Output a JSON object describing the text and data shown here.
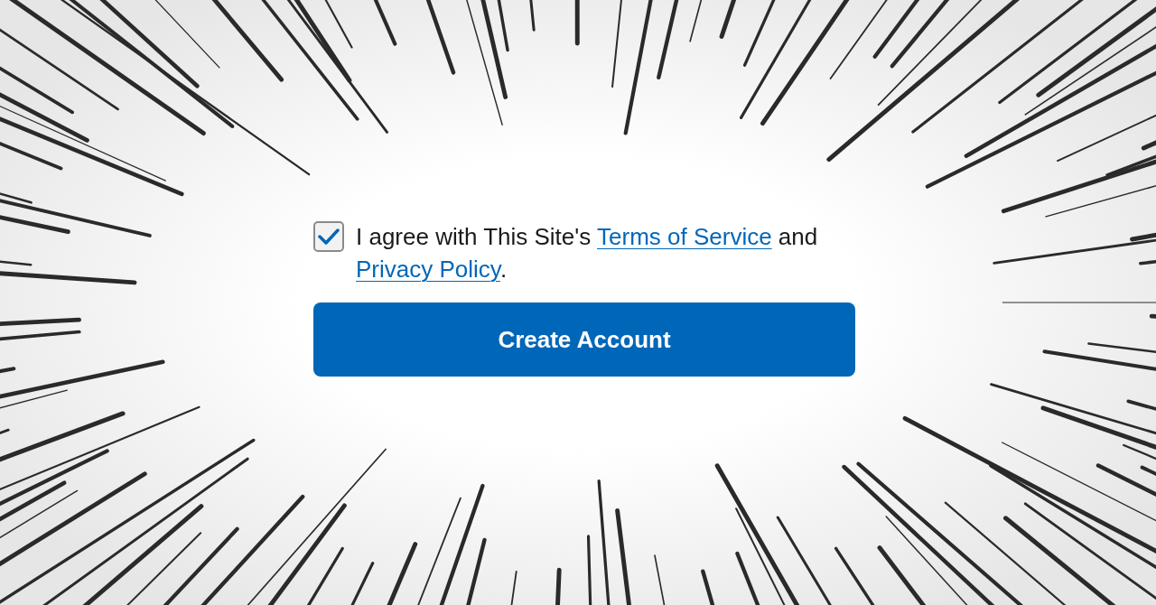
{
  "consent": {
    "checked": true,
    "parts": [
      {
        "kind": "text",
        "text": "I agree with This Site's "
      },
      {
        "kind": "link",
        "text": "Terms of Service"
      },
      {
        "kind": "text",
        "text": " and "
      },
      {
        "kind": "link",
        "text": "Privacy Policy"
      },
      {
        "kind": "text",
        "text": "."
      }
    ]
  },
  "button": {
    "label": "Create Account"
  }
}
